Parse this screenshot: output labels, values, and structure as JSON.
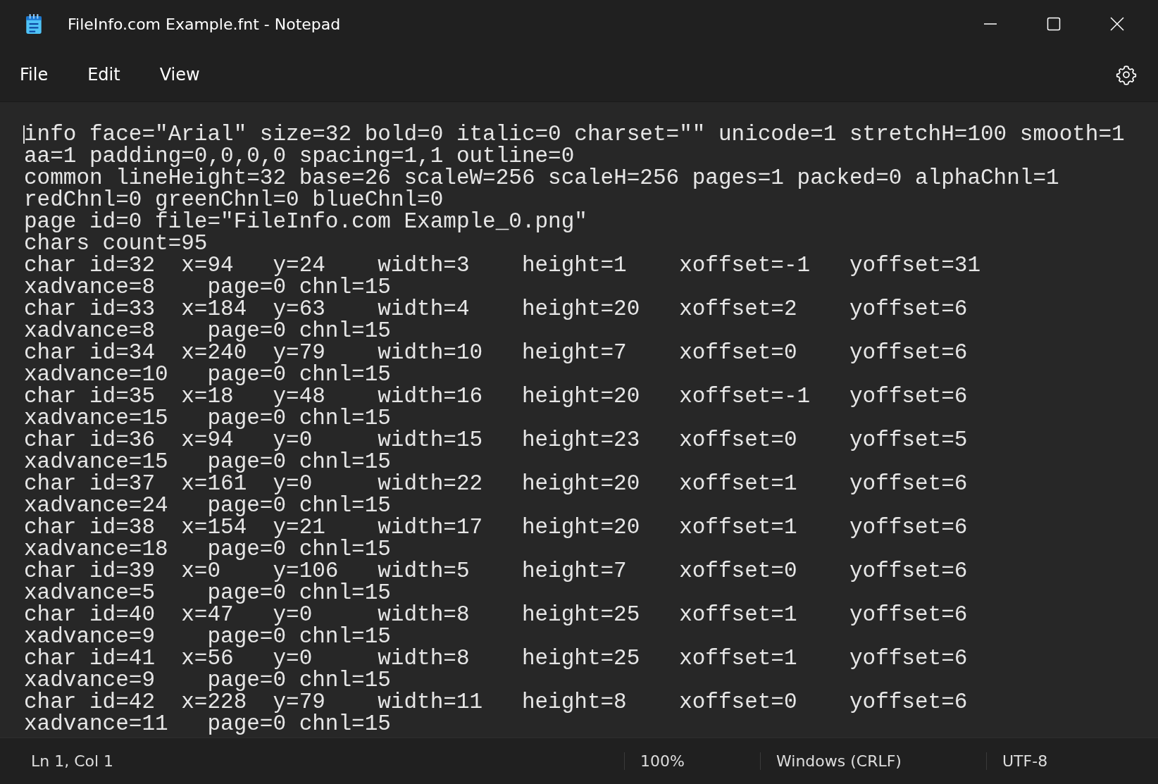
{
  "window": {
    "title": "FileInfo.com Example.fnt - Notepad"
  },
  "menu": [
    "File",
    "Edit",
    "View"
  ],
  "editor": {
    "lines": [
      {
        "kind": "plain",
        "cells": [
          "info face=\"Arial\" size=32 bold=0 italic=0 charset=\"\" unicode=1 stretchH=100 smooth=1"
        ]
      },
      {
        "kind": "plain",
        "cells": [
          "aa=1 padding=0,0,0,0 spacing=1,1 outline=0"
        ]
      },
      {
        "kind": "plain",
        "cells": [
          "common lineHeight=32 base=26 scaleW=256 scaleH=256 pages=1 packed=0 alphaChnl=1"
        ]
      },
      {
        "kind": "plain",
        "cells": [
          "redChnl=0 greenChnl=0 blueChnl=0"
        ]
      },
      {
        "kind": "plain",
        "cells": [
          "page id=0 file=\"FileInfo.com Example_0.png\""
        ]
      },
      {
        "kind": "plain",
        "cells": [
          "chars count=95"
        ]
      },
      {
        "kind": "record",
        "cells": [
          "char id=32",
          "x=94",
          "y=24",
          "width=3",
          "height=1",
          "xoffset=-1",
          "yoffset=31"
        ]
      },
      {
        "kind": "continuation",
        "cells": [
          "xadvance=8",
          "page=0",
          "chnl=15"
        ]
      },
      {
        "kind": "record",
        "cells": [
          "char id=33",
          "x=184",
          "y=63",
          "width=4",
          "height=20",
          "xoffset=2",
          "yoffset=6"
        ]
      },
      {
        "kind": "continuation",
        "cells": [
          "xadvance=8",
          "page=0",
          "chnl=15"
        ]
      },
      {
        "kind": "record",
        "cells": [
          "char id=34",
          "x=240",
          "y=79",
          "width=10",
          "height=7",
          "xoffset=0",
          "yoffset=6"
        ]
      },
      {
        "kind": "continuation",
        "cells": [
          "xadvance=10",
          "page=0",
          "chnl=15"
        ]
      },
      {
        "kind": "record",
        "cells": [
          "char id=35",
          "x=18",
          "y=48",
          "width=16",
          "height=20",
          "xoffset=-1",
          "yoffset=6"
        ]
      },
      {
        "kind": "continuation",
        "cells": [
          "xadvance=15",
          "page=0",
          "chnl=15"
        ]
      },
      {
        "kind": "record",
        "cells": [
          "char id=36",
          "x=94",
          "y=0",
          "width=15",
          "height=23",
          "xoffset=0",
          "yoffset=5"
        ]
      },
      {
        "kind": "continuation",
        "cells": [
          "xadvance=15",
          "page=0",
          "chnl=15"
        ]
      },
      {
        "kind": "record",
        "cells": [
          "char id=37",
          "x=161",
          "y=0",
          "width=22",
          "height=20",
          "xoffset=1",
          "yoffset=6"
        ]
      },
      {
        "kind": "continuation",
        "cells": [
          "xadvance=24",
          "page=0",
          "chnl=15"
        ]
      },
      {
        "kind": "record",
        "cells": [
          "char id=38",
          "x=154",
          "y=21",
          "width=17",
          "height=20",
          "xoffset=1",
          "yoffset=6"
        ]
      },
      {
        "kind": "continuation",
        "cells": [
          "xadvance=18",
          "page=0",
          "chnl=15"
        ]
      },
      {
        "kind": "record",
        "cells": [
          "char id=39",
          "x=0",
          "y=106",
          "width=5",
          "height=7",
          "xoffset=0",
          "yoffset=6"
        ]
      },
      {
        "kind": "continuation",
        "cells": [
          "xadvance=5",
          "page=0",
          "chnl=15"
        ]
      },
      {
        "kind": "record",
        "cells": [
          "char id=40",
          "x=47",
          "y=0",
          "width=8",
          "height=25",
          "xoffset=1",
          "yoffset=6"
        ]
      },
      {
        "kind": "continuation",
        "cells": [
          "xadvance=9",
          "page=0",
          "chnl=15"
        ]
      },
      {
        "kind": "record",
        "cells": [
          "char id=41",
          "x=56",
          "y=0",
          "width=8",
          "height=25",
          "xoffset=1",
          "yoffset=6"
        ]
      },
      {
        "kind": "continuation",
        "cells": [
          "xadvance=9",
          "page=0",
          "chnl=15"
        ]
      },
      {
        "kind": "record",
        "cells": [
          "char id=42",
          "x=228",
          "y=79",
          "width=11",
          "height=8",
          "xoffset=0",
          "yoffset=6"
        ]
      },
      {
        "kind": "continuation",
        "cells": [
          "xadvance=11",
          "page=0",
          "chnl=15"
        ]
      }
    ]
  },
  "status_bar": {
    "position": "Ln 1, Col 1",
    "zoom": "100%",
    "line_ending": "Windows (CRLF)",
    "encoding": "UTF-8"
  }
}
